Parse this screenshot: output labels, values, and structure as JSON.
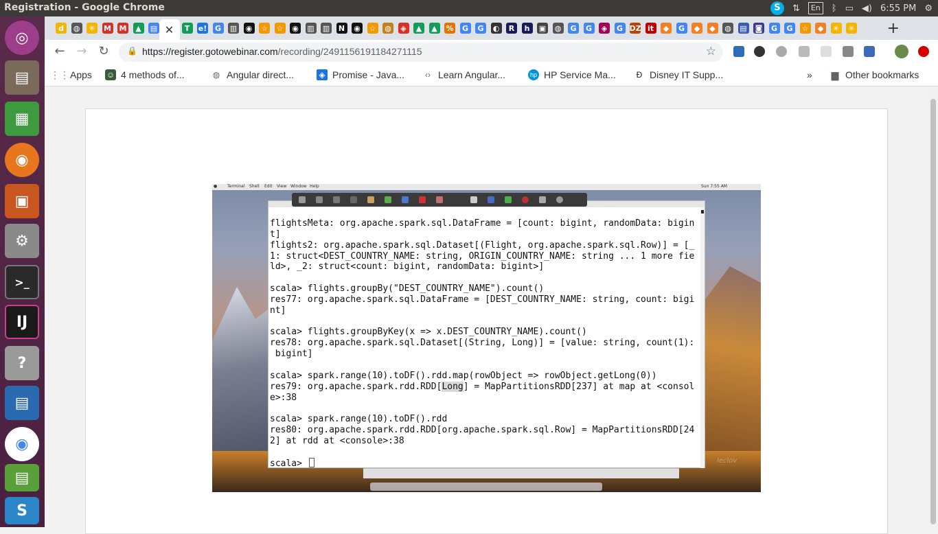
{
  "window": {
    "title": "Registration - Google Chrome"
  },
  "tray": {
    "keyboard": "En",
    "time": "6:55 PM"
  },
  "browser": {
    "url_host": "https://register.gotowebinar.com",
    "url_path": "/recording/2491156191184271115",
    "tab_favicons": [
      "d",
      "◍",
      "✳",
      "M",
      "M",
      "▲",
      "▤",
      "✕",
      "T",
      "e!",
      "G",
      "▥",
      "◉",
      "☆",
      "☆",
      "◉",
      "▥",
      "▥",
      "N",
      "◉",
      "☆",
      "◍",
      "◈",
      "▲",
      "▲",
      "%",
      "G",
      "G",
      "◐",
      "R",
      "h",
      "▣",
      "◍",
      "G",
      "G",
      "◈",
      "G",
      "DZ",
      "it",
      "◆",
      "G",
      "◆",
      "◆",
      "◍",
      "▤",
      "◙",
      "G",
      "G",
      "☆",
      "◆",
      "✳",
      "✳"
    ],
    "new_tab": "+"
  },
  "bookmarks": {
    "apps": "Apps",
    "items": [
      "4 methods of...",
      "Angular direct...",
      "Promise - Java...",
      "Learn Angular...",
      "HP Service Ma...",
      "Disney IT Supp..."
    ],
    "overflow": "»",
    "other": "Other bookmarks"
  },
  "video": {
    "mac_menu": [
      "Terminal",
      "Shell",
      "Edit",
      "View",
      "Window",
      "Help"
    ],
    "mac_clock": "Sun 7:55 AM",
    "terminal_lines": [
      "flightsMeta: org.apache.spark.sql.DataFrame = [count: bigint, randomData: bigin",
      "t]",
      "flights2: org.apache.spark.sql.Dataset[(Flight, org.apache.spark.sql.Row)] = [_",
      "1: struct<DEST_COUNTRY_NAME: string, ORIGIN_COUNTRY_NAME: string ... 1 more fie",
      "ld>, _2: struct<count: bigint, randomData: bigint>]",
      "",
      "scala> flights.groupBy(\"DEST_COUNTRY_NAME\").count()",
      "res77: org.apache.spark.sql.DataFrame = [DEST_COUNTRY_NAME: string, count: bigi",
      "nt]",
      "",
      "scala> flights.groupByKey(x => x.DEST_COUNTRY_NAME).count()",
      "res78: org.apache.spark.sql.Dataset[(String, Long)] = [value: string, count(1):",
      " bigint]",
      "",
      "scala> spark.range(10).toDF().rdd.map(rowObject => rowObject.getLong(0))",
      "",
      "e>:38",
      "",
      "scala> spark.range(10).toDF().rdd",
      "res80: org.apache.spark.rdd.RDD[org.apache.spark.sql.Row] = MapPartitionsRDD[24",
      "2] at rdd at <console>:38",
      "",
      "scala> "
    ],
    "res79_prefix": "res79: org.apache.spark.rdd.RDD[",
    "res79_highlight": "Long",
    "res79_suffix": "] = MapPartitionsRDD[237] at map at <consol",
    "watermark": "leclov"
  },
  "colors": {
    "tab_strip": "#dee1e6",
    "launcher": "#4a2040",
    "topbar": "#3b3a37"
  }
}
